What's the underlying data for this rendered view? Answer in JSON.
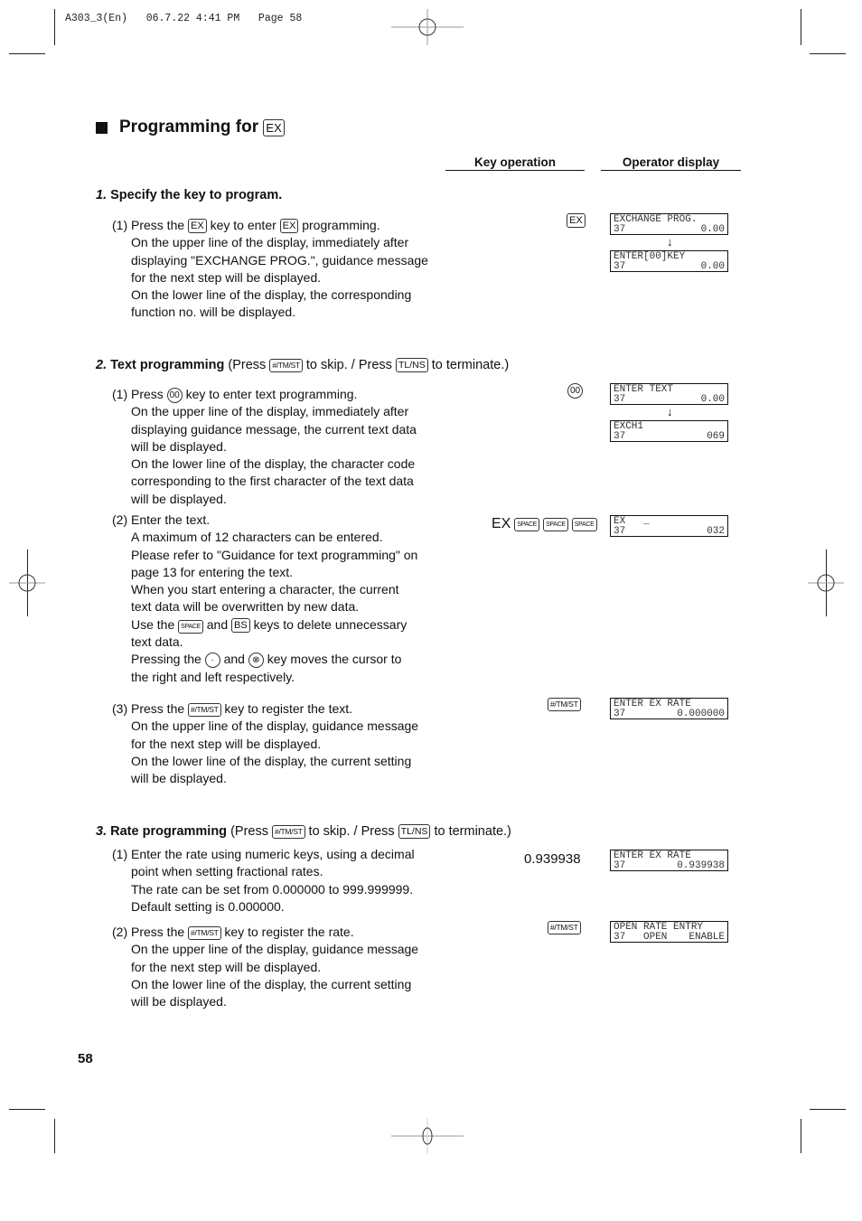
{
  "print_header": "A303_3(En)   06.7.22 4:41 PM   Page 58",
  "title": {
    "text": "Programming for",
    "key": "EX"
  },
  "columns": {
    "key_operation": "Key operation",
    "operator_display": "Operator display"
  },
  "keys": {
    "ex": "EX",
    "tmst": "#/TM/ST",
    "tlns": "TL/NS",
    "k00": "00",
    "space": "SPACE",
    "bs": "BS",
    "dot": "·",
    "x": "⊗"
  },
  "step1": {
    "num": "1.",
    "heading": "Specify the key to program.",
    "sub1": {
      "label": "(1) Press the",
      "mid": "key to enter",
      "end": "programming.",
      "lines": [
        "On the upper line of the display, immediately after",
        "displaying \"EXCHANGE PROG.\", guidance message",
        "for the next step will be displayed.",
        "On the lower line of the display, the corresponding",
        "function no. will be displayed."
      ],
      "key_op": "EX",
      "displays": [
        {
          "upper": "EXCHANGE PROG.",
          "lower_left": "37",
          "lower_right": "0.00"
        },
        {
          "upper": "ENTER[00]KEY",
          "lower_left": "37",
          "lower_right": "0.00"
        }
      ]
    }
  },
  "step2": {
    "num": "2.",
    "heading": "Text programming",
    "paren_a": "(Press",
    "paren_b": "to skip. / Press",
    "paren_c": "to terminate.)",
    "sub1": {
      "label": "(1) Press",
      "end": "key to enter text programming.",
      "lines": [
        "On the upper line of the display, immediately after",
        "displaying guidance message, the current text data",
        "will be displayed.",
        "On the lower line of the display, the character code",
        "corresponding to the first character of the text data",
        "will be displayed."
      ],
      "displays": [
        {
          "upper": "ENTER TEXT",
          "lower_left": "37",
          "lower_right": "0.00"
        },
        {
          "upper": "EXCH1",
          "lower_left": "37",
          "lower_right": "069"
        }
      ]
    },
    "sub2": {
      "label": "(2) Enter the text.",
      "lines_a": [
        "A maximum of 12 characters can be entered.",
        "Please refer to \"Guidance for text programming\" on",
        "page 13 for entering the text.",
        "When you start entering a character, the current",
        "text data will be overwritten by new data."
      ],
      "use_the": "Use the",
      "and": "and",
      "keys_delete": "keys to delete unnecessary",
      "text_data": "text data.",
      "pressing_the": "Pressing the",
      "key_moves": "key moves the cursor to",
      "right_left": "the right and left respectively.",
      "key_op_text": "EX",
      "display": {
        "upper": "EX   _",
        "lower_left": "37",
        "lower_right": "032"
      }
    },
    "sub3": {
      "label": "(3) Press the",
      "end": "key to register the text.",
      "lines": [
        "On the upper line of the display, guidance message",
        "for the next step will be displayed.",
        "On the lower line of the display, the current setting",
        "will be displayed."
      ],
      "display": {
        "upper": "ENTER EX RATE",
        "lower_left": "37",
        "lower_right": "0.000000"
      }
    }
  },
  "step3": {
    "num": "3.",
    "heading": "Rate programming",
    "paren_a": "(Press",
    "paren_b": "to skip. / Press",
    "paren_c": "to terminate.)",
    "sub1": {
      "lines": [
        "(1) Enter the rate using numeric keys, using a decimal",
        "point when setting fractional rates.",
        "The rate can be set from 0.000000 to 999.999999.",
        "Default setting is 0.000000."
      ],
      "key_op": "0.939938",
      "display": {
        "upper": "ENTER EX RATE",
        "lower_left": "37",
        "lower_right": "0.939938"
      }
    },
    "sub2": {
      "label": "(2) Press the",
      "end": "key to register the rate.",
      "lines": [
        "On the upper line of the display, guidance message",
        "for the next step will be displayed.",
        "On the lower line of the display, the current setting",
        "will be displayed."
      ],
      "display": {
        "upper": "OPEN RATE ENTRY",
        "lower_left": "37   OPEN",
        "lower_right": "ENABLE"
      }
    }
  },
  "page_number": "58"
}
